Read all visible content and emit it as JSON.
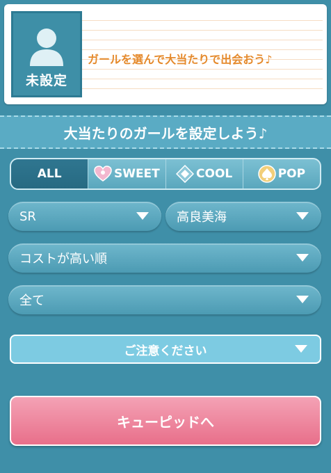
{
  "top_card": {
    "avatar_label": "未設定",
    "message": "ガールを選んで大当たりで出会おう♪"
  },
  "banner": {
    "text": "大当たりのガールを設定しよう♪"
  },
  "tabs": [
    {
      "label": "ALL",
      "icon": "",
      "active": true
    },
    {
      "label": "SWEET",
      "icon": "heart-icon",
      "active": false
    },
    {
      "label": "COOL",
      "icon": "diamond-icon",
      "active": false
    },
    {
      "label": "POP",
      "icon": "spade-icon",
      "active": false
    }
  ],
  "filters": {
    "rarity": "SR",
    "girl": "高良美海",
    "sort": "コストが高い順",
    "category": "全て"
  },
  "caution": {
    "label": "ご注意ください"
  },
  "action": {
    "label": "キューピッドへ"
  },
  "colors": {
    "background": "#3f8fa8",
    "accent_orange": "#e58a2c",
    "pink_button": "#e86f8a",
    "active_tab": "#2f7690"
  }
}
